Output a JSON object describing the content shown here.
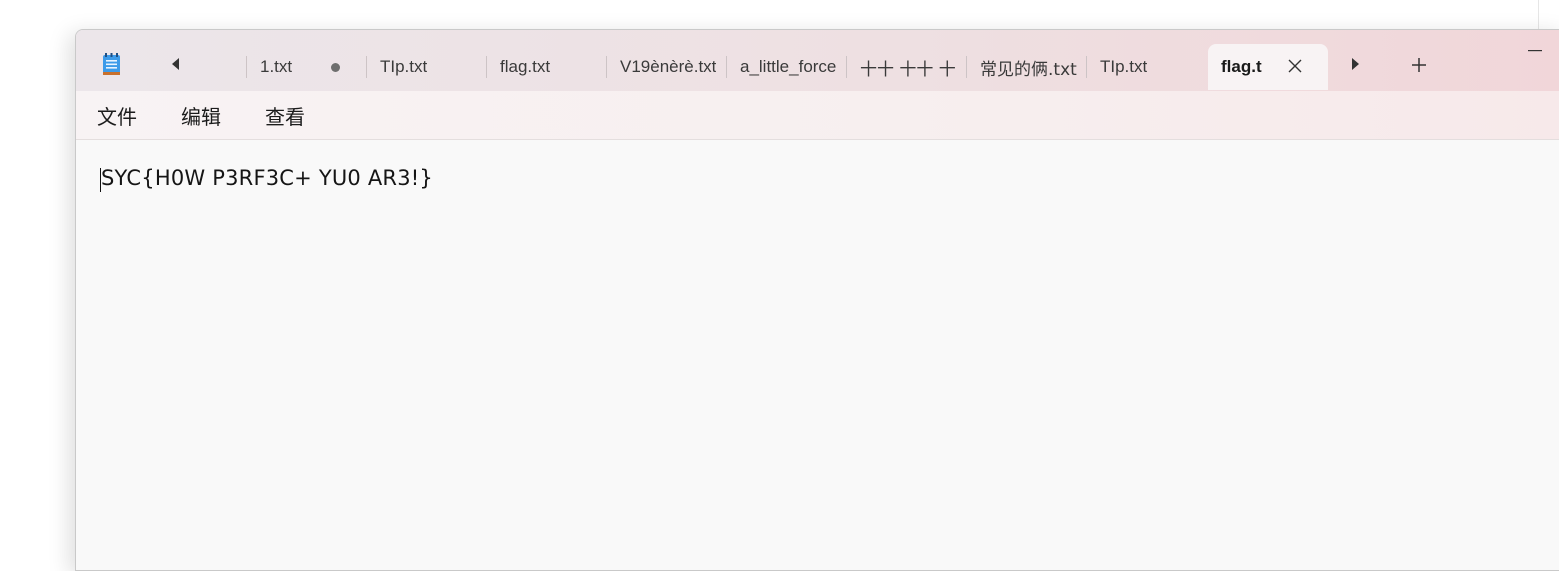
{
  "window": {
    "title_icon": "notepad-icon",
    "tabs": [
      {
        "label": "1.txt",
        "unsaved": true
      },
      {
        "label": "TIp.txt",
        "unsaved": false
      },
      {
        "label": "flag.txt",
        "unsaved": false
      },
      {
        "label": "V19ènèrè.txt",
        "unsaved": false
      },
      {
        "label": "a_little_force",
        "unsaved": false
      },
      {
        "label": "十十 十十 十",
        "unsaved": false
      },
      {
        "label": "常见的俩.txt",
        "unsaved": false
      },
      {
        "label": "TIp.txt",
        "unsaved": false
      },
      {
        "label": "flag.t",
        "unsaved": false,
        "active": true
      }
    ],
    "nav": {
      "prev_icon": "chevron-left-icon",
      "next_icon": "chevron-right-icon",
      "new_tab_icon": "plus-icon"
    },
    "controls": {
      "minimize_icon": "minimize-icon",
      "close_tab_icon": "close-icon"
    }
  },
  "menu": {
    "items": [
      "文件",
      "编辑",
      "查看"
    ]
  },
  "editor": {
    "text": "SYC{H0W P3RF3C+ YU0 AR3!}"
  },
  "colors": {
    "titlebar_start": "#ece6ea",
    "titlebar_end": "#f1d6d9",
    "editor_bg": "#f9f9f9",
    "active_tab_bg": "#f8f3f4"
  }
}
